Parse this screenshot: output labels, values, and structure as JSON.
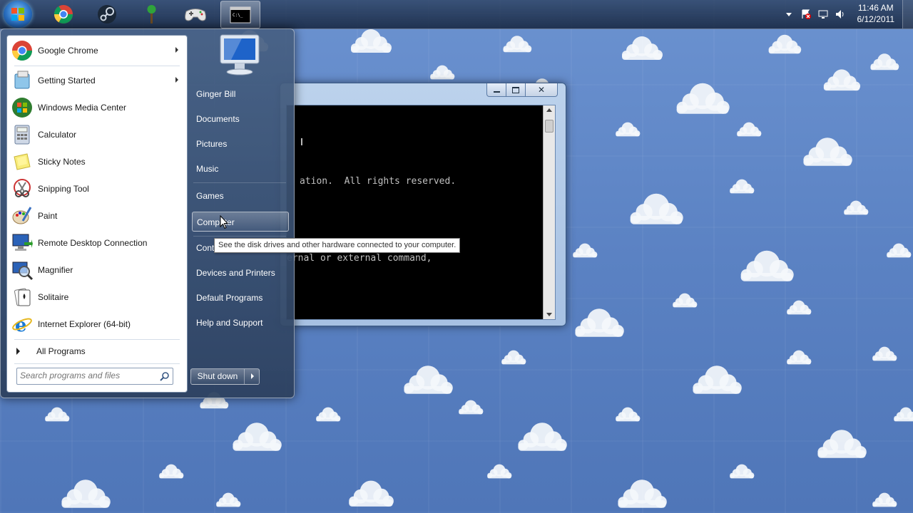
{
  "taskbar": {
    "pinned": [
      "start-orb",
      "chrome-icon",
      "steam-icon",
      "tree-app-icon",
      "gamepad-icon",
      "cmd-icon"
    ],
    "clock_time": "11:46 AM",
    "clock_date": "6/12/2011"
  },
  "cmd_window": {
    "line1": "ation.  All rights reserved.",
    "line2": "ernal or external command,"
  },
  "start_menu": {
    "programs": [
      {
        "label": "Google Chrome",
        "has_submenu": true
      },
      {
        "label": "Getting Started",
        "has_submenu": true
      },
      {
        "label": "Windows Media Center",
        "has_submenu": false
      },
      {
        "label": "Calculator",
        "has_submenu": false
      },
      {
        "label": "Sticky Notes",
        "has_submenu": false
      },
      {
        "label": "Snipping Tool",
        "has_submenu": false
      },
      {
        "label": "Paint",
        "has_submenu": false
      },
      {
        "label": "Remote Desktop Connection",
        "has_submenu": false
      },
      {
        "label": "Magnifier",
        "has_submenu": false
      },
      {
        "label": "Solitaire",
        "has_submenu": false
      },
      {
        "label": "Internet Explorer (64-bit)",
        "has_submenu": false
      }
    ],
    "all_programs": "All Programs",
    "search_placeholder": "Search programs and files",
    "right": {
      "user": "Ginger Bill",
      "documents": "Documents",
      "pictures": "Pictures",
      "music": "Music",
      "games": "Games",
      "computer": "Computer",
      "control_panel": "Cont",
      "devices": "Devices and Printers",
      "default_programs": "Default Programs",
      "help": "Help and Support"
    },
    "shutdown": "Shut down"
  },
  "tooltip": "See the disk drives and other hardware connected to your computer.",
  "colors": {
    "desktop_blue": "#5b83c4",
    "taskbar": "#1e2e48",
    "console_bg": "#000000",
    "console_text": "#c0c0c0"
  }
}
